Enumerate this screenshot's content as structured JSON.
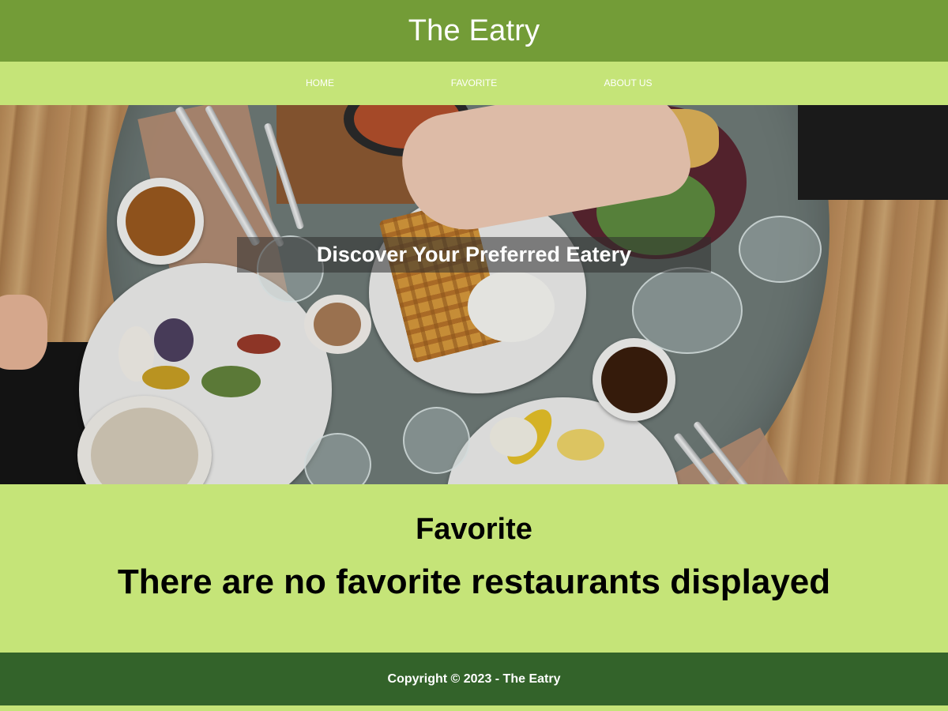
{
  "header": {
    "title": "The Eatry"
  },
  "nav": {
    "items": [
      {
        "label": "HOME"
      },
      {
        "label": "FAVORITE"
      },
      {
        "label": "ABOUT US"
      }
    ]
  },
  "hero": {
    "caption": "Discover Your Preferred Eatery"
  },
  "favorite": {
    "title": "Favorite",
    "empty_message": "There are no favorite restaurants displayed"
  },
  "footer": {
    "copyright": "Copyright © 2023 - The Eatry"
  },
  "colors": {
    "header_bg": "#739c37",
    "nav_bg": "#c5e478",
    "section_bg": "#c5e478",
    "footer_bg": "#33632a"
  }
}
